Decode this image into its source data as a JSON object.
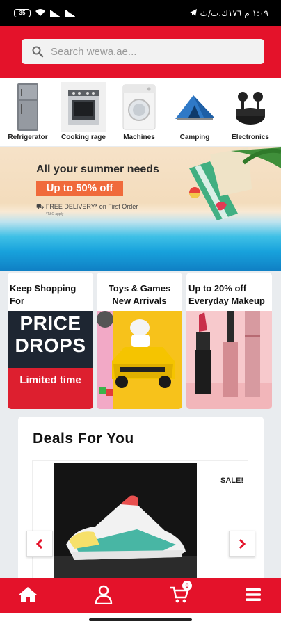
{
  "status_bar": {
    "battery": "35",
    "time_text": "١:٠٩ م",
    "data_text": "١٧٦ك.ب/ث"
  },
  "search": {
    "placeholder": "Search wewa.ae..."
  },
  "categories": [
    {
      "label": "Refrigerator",
      "icon": "refrigerator-icon"
    },
    {
      "label": "Cooking rage",
      "icon": "cooking-range-icon"
    },
    {
      "label": "Machines",
      "icon": "washing-machine-icon"
    },
    {
      "label": "Camping",
      "icon": "tent-icon"
    },
    {
      "label": "Electronics",
      "icon": "earbuds-icon"
    }
  ],
  "banner": {
    "title": "All your summer needs",
    "offer": "Up to 50% off",
    "delivery": "FREE DELIVERY* on First Order",
    "terms": "*T&C apply"
  },
  "promos": [
    {
      "title": "Keep Shopping For",
      "image_words": [
        "PRICE",
        "DROPS"
      ],
      "image_tagline": "Limited time"
    },
    {
      "title": "Toys & Games New Arrivals"
    },
    {
      "title": "Up to 20% off Everyday Makeup"
    }
  ],
  "deals": {
    "title": "Deals For You",
    "sale_text": "SALE!",
    "prev_icon": "chevron-left-icon",
    "next_icon": "chevron-right-icon"
  },
  "bottom_nav": {
    "cart_count": "0",
    "items": [
      "home-icon",
      "account-icon",
      "cart-icon",
      "menu-icon"
    ]
  },
  "colors": {
    "brand_red": "#e4122a",
    "offer_orange": "#f06a3b"
  }
}
